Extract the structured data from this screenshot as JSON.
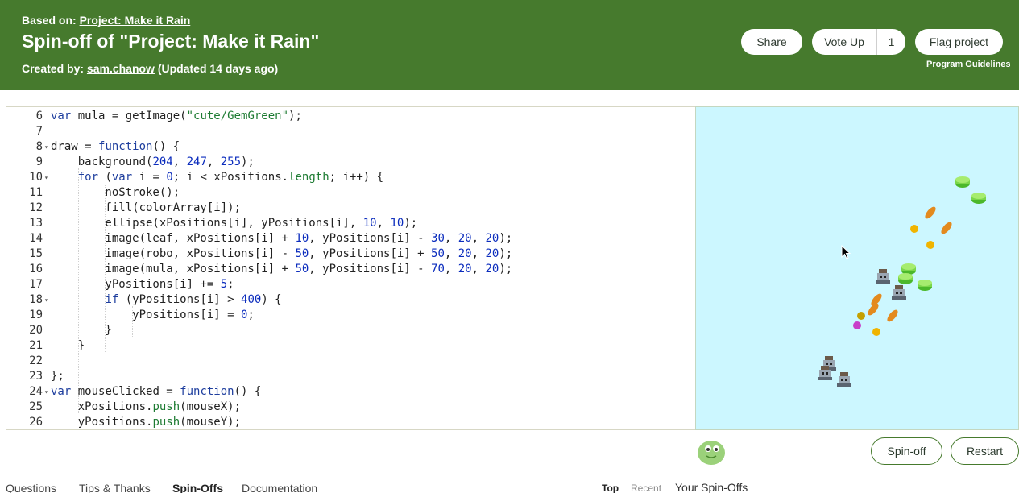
{
  "header": {
    "based_on_label": "Based on:",
    "based_on_link": "Project: Make it Rain",
    "title": "Spin-off of \"Project: Make it Rain\"",
    "created_by_label": "Created by:",
    "author": "sam.chanow",
    "updated": "(Updated 14 days ago)",
    "share_label": "Share",
    "vote_label": "Vote Up",
    "vote_count": "1",
    "flag_label": "Flag project",
    "guidelines_label": "Program Guidelines"
  },
  "editor": {
    "lines": [
      {
        "n": "6",
        "fold": false
      },
      {
        "n": "7",
        "fold": false
      },
      {
        "n": "8",
        "fold": true
      },
      {
        "n": "9",
        "fold": false
      },
      {
        "n": "10",
        "fold": true
      },
      {
        "n": "11",
        "fold": false
      },
      {
        "n": "12",
        "fold": false
      },
      {
        "n": "13",
        "fold": false
      },
      {
        "n": "14",
        "fold": false
      },
      {
        "n": "15",
        "fold": false
      },
      {
        "n": "16",
        "fold": false
      },
      {
        "n": "17",
        "fold": false
      },
      {
        "n": "18",
        "fold": true
      },
      {
        "n": "19",
        "fold": false
      },
      {
        "n": "20",
        "fold": false
      },
      {
        "n": "21",
        "fold": false
      },
      {
        "n": "22",
        "fold": false
      },
      {
        "n": "23",
        "fold": false
      },
      {
        "n": "24",
        "fold": true
      },
      {
        "n": "25",
        "fold": false
      },
      {
        "n": "26",
        "fold": false
      }
    ],
    "code": [
      "var mula = getImage(\"cute/GemGreen\");",
      "",
      "draw = function() {",
      "    background(204, 247, 255);",
      "    for (var i = 0; i < xPositions.length; i++) {",
      "        noStroke();",
      "        fill(colorArray[i]);",
      "        ellipse(xPositions[i], yPositions[i], 10, 10);",
      "        image(leaf, xPositions[i] + 10, yPositions[i] - 30, 20, 20);",
      "        image(robo, xPositions[i] - 50, yPositions[i] + 50, 20, 20);",
      "        image(mula, xPositions[i] + 50, yPositions[i] - 70, 20, 20);",
      "        yPositions[i] += 5;",
      "        if (yPositions[i] > 400) {",
      "            yPositions[i] = 0;",
      "        }",
      "    }",
      "",
      "};",
      "var mouseClicked = function() {",
      "    xPositions.push(mouseX);",
      "    yPositions.push(mouseY);"
    ]
  },
  "canvas": {
    "background": "#ccf7ff",
    "icons": [
      "gem-green-icon",
      "leaf-icon",
      "robot-icon",
      "mouse-cursor-icon"
    ]
  },
  "actions": {
    "spinoff_label": "Spin-off",
    "restart_label": "Restart"
  },
  "tabs": [
    "Questions",
    "Tips & Thanks",
    "Spin-Offs",
    "Documentation"
  ],
  "active_tab": "Spin-Offs",
  "sort": {
    "top": "Top",
    "recent": "Recent",
    "yours": "Your Spin-Offs"
  },
  "colors": {
    "header_bg": "#467a2d",
    "canvas_bg": "#ccf7ff",
    "accent_green": "#467a2d"
  }
}
